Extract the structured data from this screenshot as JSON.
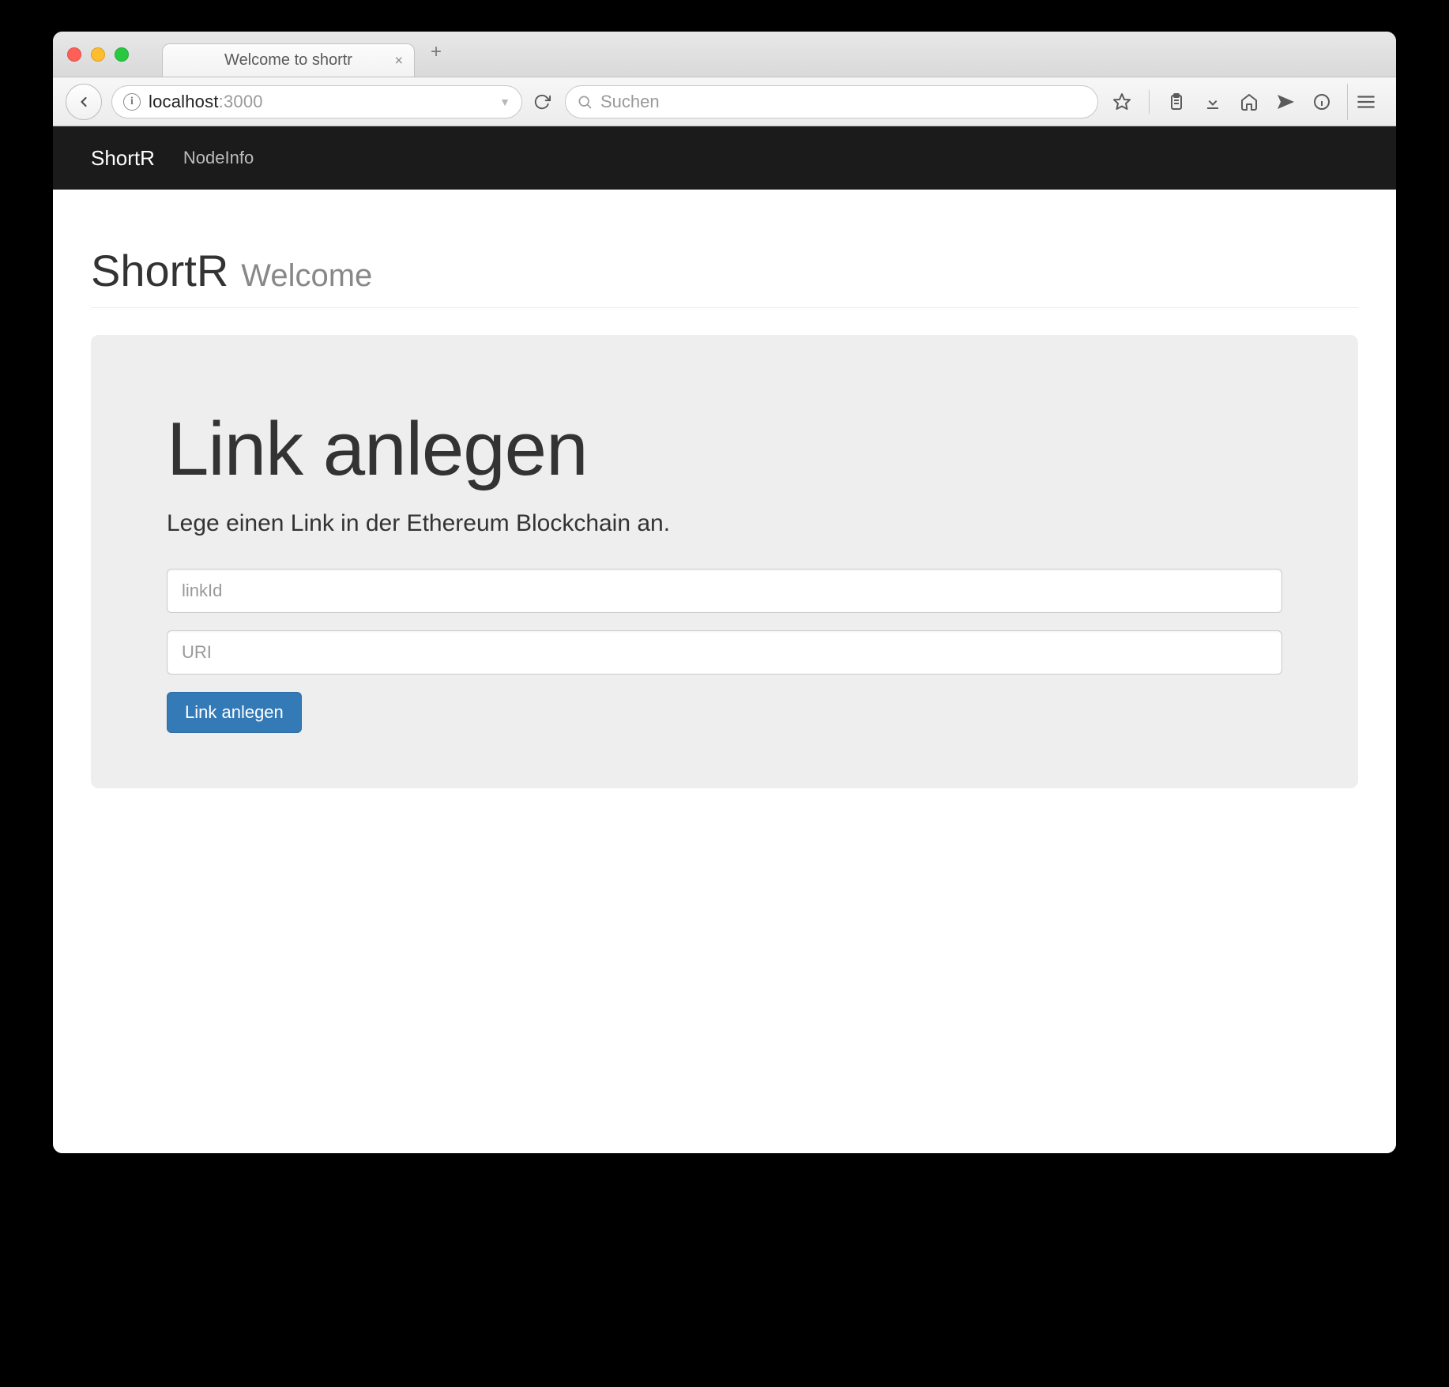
{
  "browser": {
    "tab_title": "Welcome to shortr",
    "url_host": "localhost",
    "url_rest": ":3000",
    "search_placeholder": "Suchen"
  },
  "navbar": {
    "brand": "ShortR",
    "items": [
      {
        "label": "NodeInfo"
      }
    ]
  },
  "header": {
    "title": "ShortR",
    "subtitle": "Welcome"
  },
  "jumbotron": {
    "heading": "Link anlegen",
    "lead": "Lege einen Link in der Ethereum Blockchain an.",
    "fields": {
      "linkid_placeholder": "linkId",
      "uri_placeholder": "URI"
    },
    "submit_label": "Link anlegen"
  }
}
